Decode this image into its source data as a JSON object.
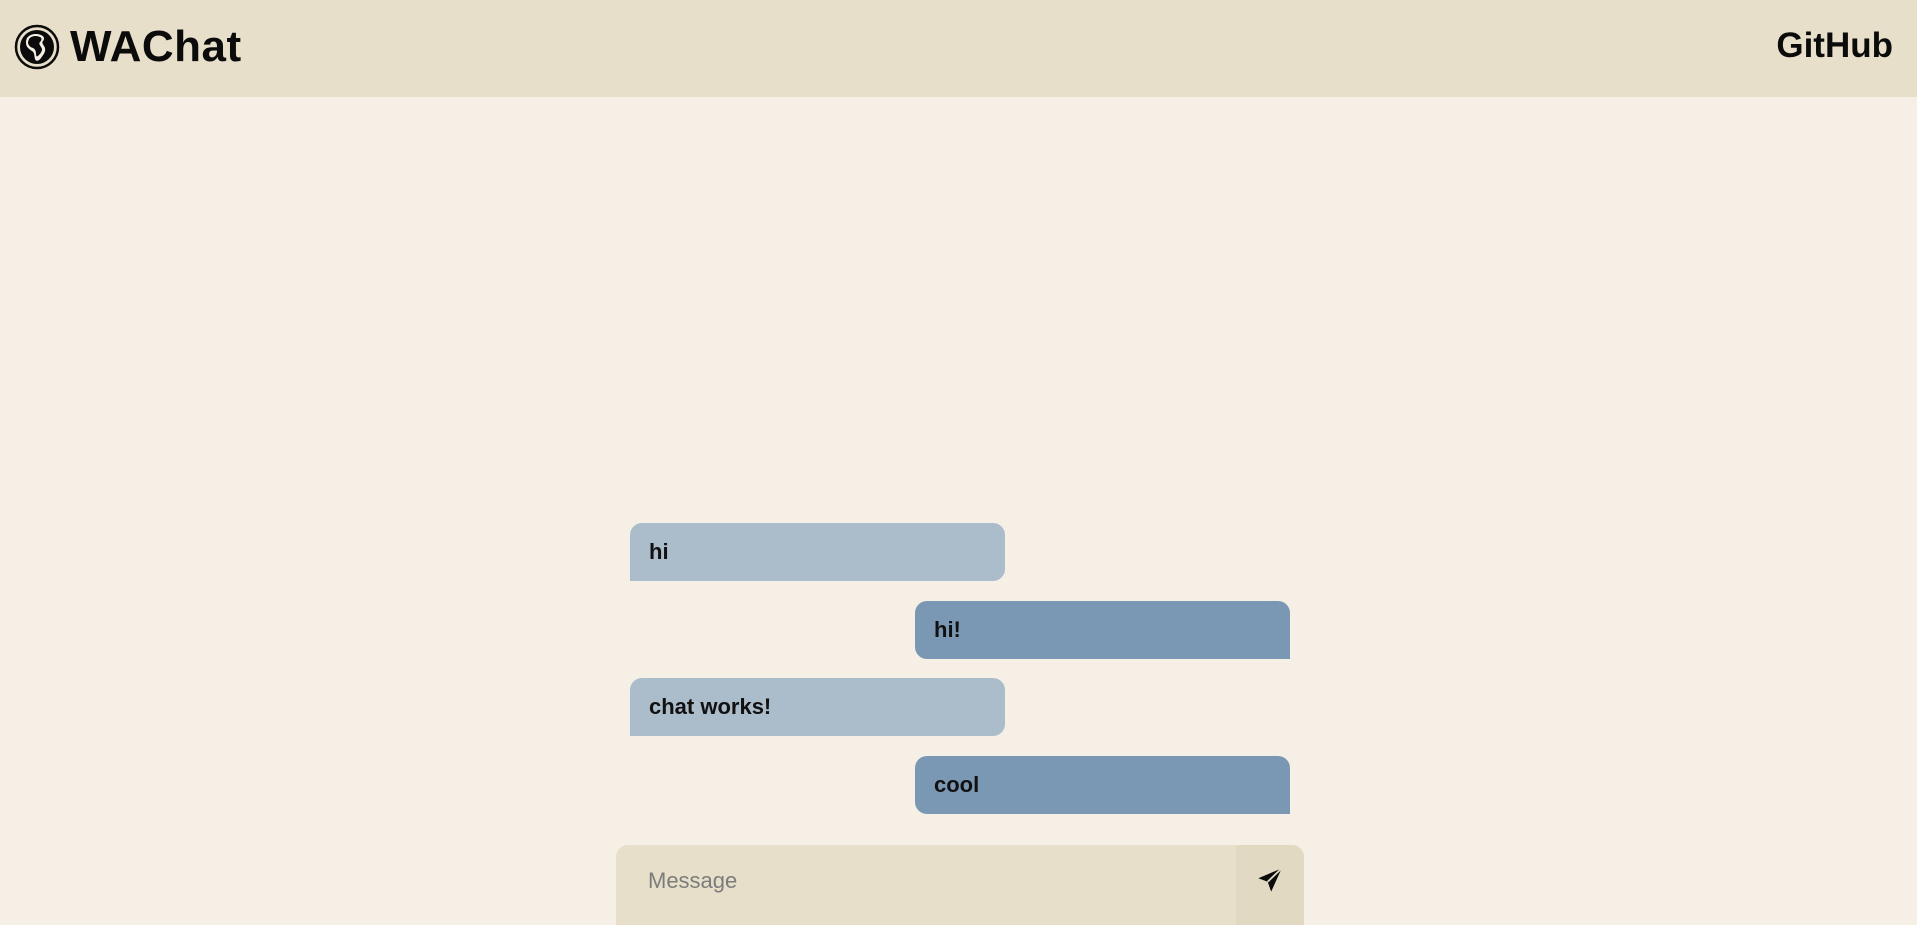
{
  "header": {
    "brand_label": "WAChat",
    "brand_icon": "globe-africa-icon",
    "github_label": "GitHub"
  },
  "messages": [
    {
      "text": "hi",
      "direction": "incoming"
    },
    {
      "text": "hi!",
      "direction": "outgoing"
    },
    {
      "text": "chat works!",
      "direction": "incoming"
    },
    {
      "text": "cool",
      "direction": "outgoing"
    }
  ],
  "composer": {
    "placeholder": "Message",
    "value": "",
    "send_icon": "send-icon"
  },
  "colors": {
    "background": "#f6efe5",
    "header_bg": "#e7dfc9",
    "incoming_bubble": "#abbccb",
    "outgoing_bubble": "#7a97b3",
    "composer_bg": "#e7dfc9"
  }
}
